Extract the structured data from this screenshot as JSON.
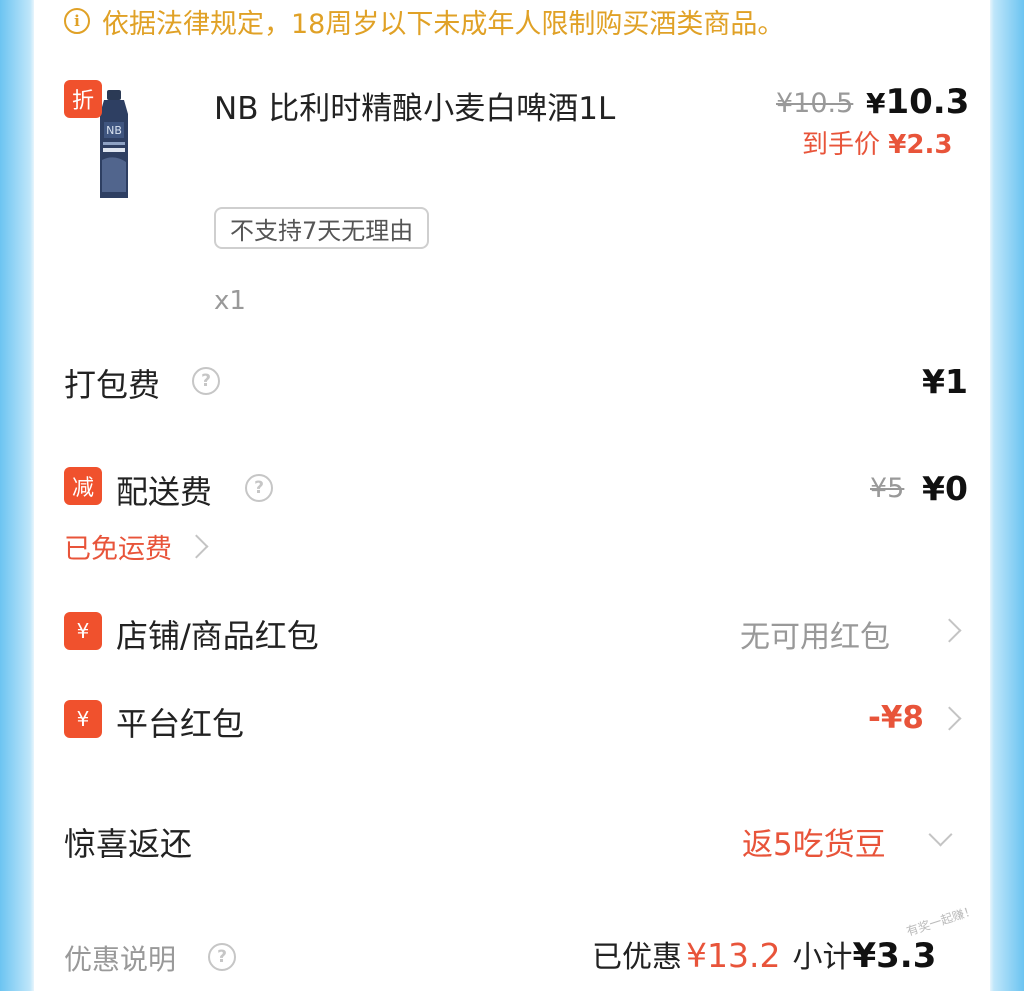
{
  "notice": {
    "icon": "info-icon",
    "text": "依据法律规定，18周岁以下未成年人限制购买酒类商品。",
    "color": "#e0a126"
  },
  "product": {
    "discount_badge": "折",
    "title": "NB 比利时精酿小麦白啤酒1L",
    "tag": "不支持7天无理由",
    "quantity": "x1",
    "original_price": "¥10.5",
    "price_symbol": "¥",
    "price": "10.3",
    "hand_price_label": "到手价",
    "hand_price": "¥2.3"
  },
  "packing_fee": {
    "label": "打包费",
    "help_icon": "?",
    "value": "¥1"
  },
  "delivery_fee": {
    "badge": "减",
    "label": "配送费",
    "help_icon": "?",
    "original": "¥5",
    "value": "¥0",
    "free_note": "已免运费"
  },
  "store_coupon": {
    "badge": "¥",
    "label": "店铺/商品红包",
    "value": "无可用红包"
  },
  "platform_coupon": {
    "badge": "¥",
    "label": "平台红包",
    "value": "-¥8"
  },
  "surprise": {
    "label": "惊喜返还",
    "value": "返5吃货豆"
  },
  "summary": {
    "label": "优惠说明",
    "help_icon": "?",
    "discount_label": "已优惠",
    "discount_value": "¥13.2",
    "subtotal_label": "小计",
    "subtotal_value": "¥3.3"
  },
  "watermark": "有奖一起赚！",
  "colors": {
    "accent_red": "#e8543a",
    "badge_red": "#f0512d",
    "notice_orange": "#e0a126"
  }
}
